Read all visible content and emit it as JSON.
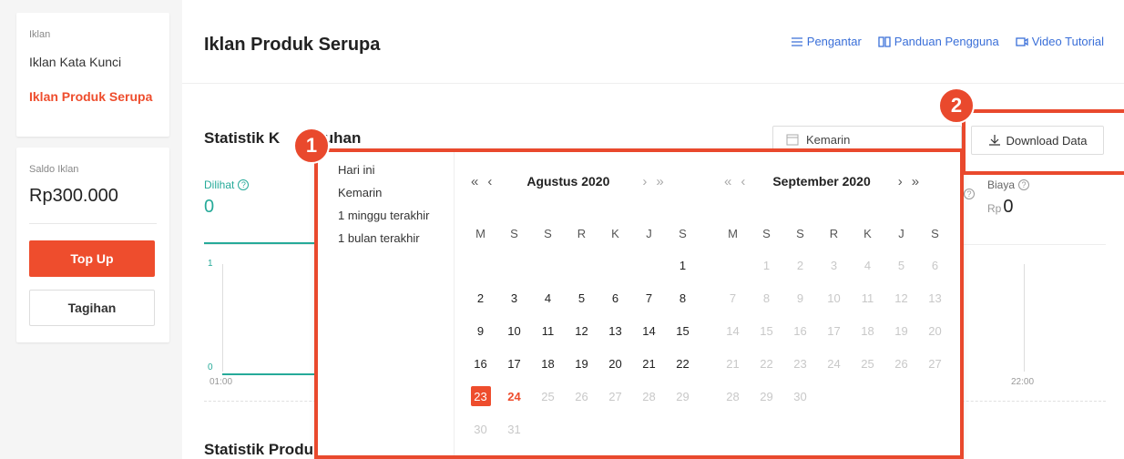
{
  "sidebar": {
    "section_label": "Iklan",
    "items": [
      {
        "label": "Iklan Kata Kunci"
      },
      {
        "label": "Iklan Produk Serupa"
      }
    ],
    "saldo_label": "Saldo Iklan",
    "saldo_value": "Rp300.000",
    "topup_label": "Top Up",
    "tagihan_label": "Tagihan"
  },
  "header": {
    "title": "Iklan Produk Serupa",
    "links": [
      {
        "label": "Pengantar",
        "icon": "list-icon"
      },
      {
        "label": "Panduan Pengguna",
        "icon": "book-icon"
      },
      {
        "label": "Video Tutorial",
        "icon": "video-icon"
      }
    ]
  },
  "stats": {
    "title_left": "Statistik K",
    "title_right": "ruhan",
    "date_value": "Kemarin",
    "download_label": "Download Data",
    "dilihat_label": "Dilihat",
    "dilihat_value": "0",
    "biaya_label": "Biaya",
    "biaya_currency": "Rp",
    "biaya_value": "0",
    "y_max": "1",
    "y_min": "0",
    "x_start": "01:00",
    "x_end": "22:00",
    "product_title": "Statistik Produ"
  },
  "popup": {
    "shortcuts": [
      "Hari ini",
      "Kemarin",
      "1 minggu terakhir",
      "1 bulan terakhir"
    ],
    "weekdays": [
      "M",
      "S",
      "S",
      "R",
      "K",
      "J",
      "S"
    ],
    "left_month": "Agustus 2020",
    "right_month": "September 2020",
    "nav_prev_year": "«",
    "nav_prev": "‹",
    "nav_next": "›",
    "nav_next_year": "»"
  },
  "badges": {
    "one": "1",
    "two": "2"
  },
  "colors": {
    "accent": "#ee4d2d",
    "teal": "#26aa99",
    "annotation": "#e9492d",
    "link": "#3a6fd8"
  }
}
